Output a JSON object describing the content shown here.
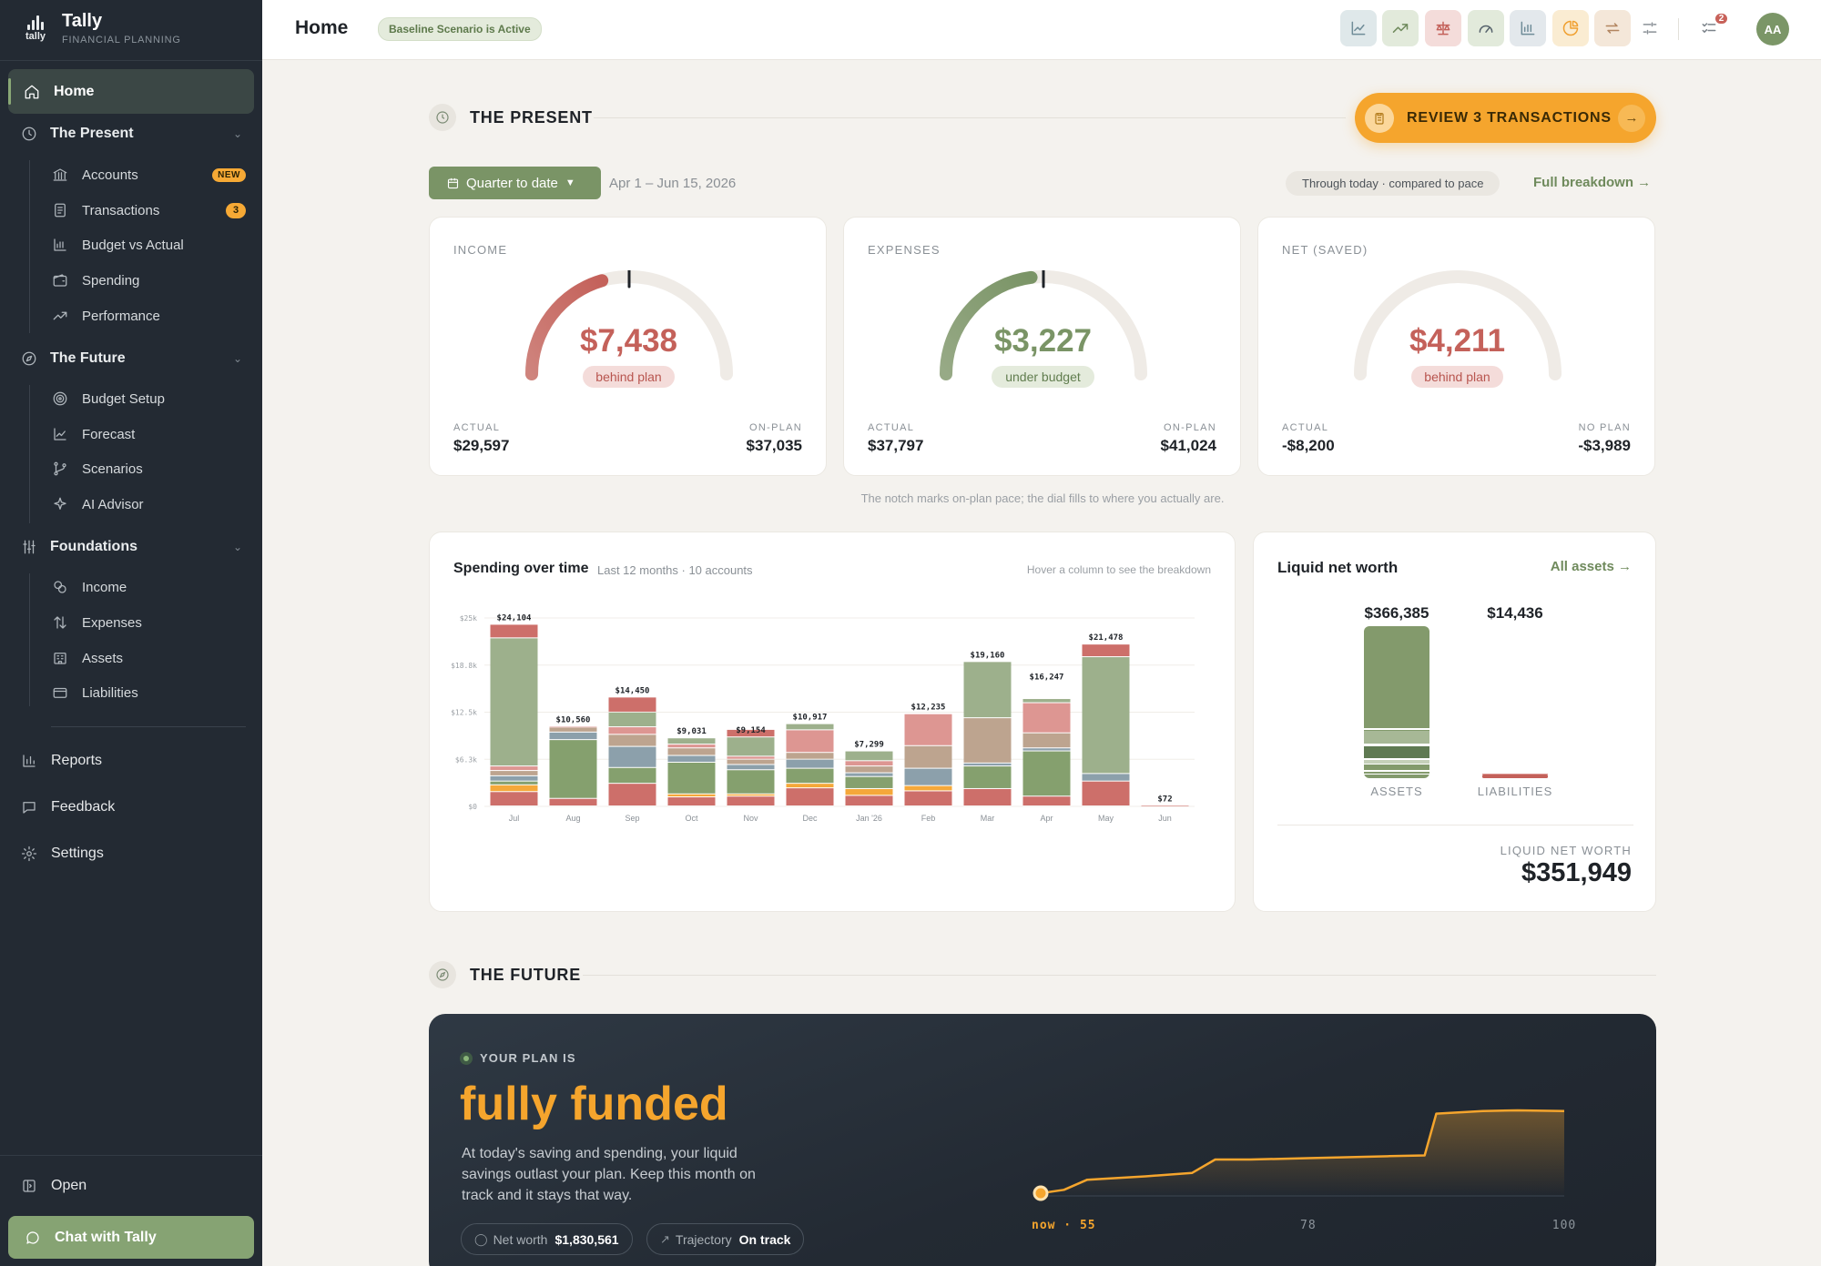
{
  "brand": {
    "name": "Tally",
    "subtitle": "FINANCIAL PLANNING",
    "logo_word": "tally"
  },
  "sidebar": {
    "home": "Home",
    "groups": [
      {
        "label": "The Present",
        "items": [
          {
            "label": "Accounts",
            "icon": "bank-icon",
            "badge": "NEW"
          },
          {
            "label": "Transactions",
            "icon": "receipt-icon",
            "badge": "3"
          },
          {
            "label": "Budget vs Actual",
            "icon": "bar-chart-icon"
          },
          {
            "label": "Spending",
            "icon": "wallet-icon"
          },
          {
            "label": "Performance",
            "icon": "trend-icon"
          }
        ]
      },
      {
        "label": "The Future",
        "items": [
          {
            "label": "Budget Setup",
            "icon": "target-icon"
          },
          {
            "label": "Forecast",
            "icon": "line-chart-icon"
          },
          {
            "label": "Scenarios",
            "icon": "branch-icon"
          },
          {
            "label": "AI Advisor",
            "icon": "sparkle-icon"
          }
        ]
      },
      {
        "label": "Foundations",
        "items": [
          {
            "label": "Income",
            "icon": "coins-icon"
          },
          {
            "label": "Expenses",
            "icon": "arrows-updown-icon"
          },
          {
            "label": "Assets",
            "icon": "building-icon"
          },
          {
            "label": "Liabilities",
            "icon": "card-icon"
          }
        ]
      }
    ],
    "reports": "Reports",
    "feedback": "Feedback",
    "settings": "Settings",
    "open": "Open",
    "chat": "Chat with Tally"
  },
  "topbar": {
    "title": "Home",
    "scenario": "Baseline Scenario is Active",
    "notifications": "2",
    "avatar": "AA",
    "tools": [
      "line-chart-icon",
      "trend-up-icon",
      "scale-icon",
      "gauge-icon",
      "bar-chart-icon",
      "pie-chart-icon",
      "repeat-icon",
      "sliders-icon"
    ]
  },
  "present": {
    "title": "THE PRESENT",
    "review_label": "REVIEW 3 TRANSACTIONS",
    "range_label": "Quarter to date",
    "range_dates": "Apr 1 – Jun 15, 2026",
    "pace_pill": "Through today · compared to pace",
    "full_breakdown": "Full breakdown →",
    "note": "The notch marks on-plan pace; the dial fills to where you actually are.",
    "gauges": [
      {
        "label": "INCOME",
        "value": "$7,438",
        "status": "behind plan",
        "fill_fraction": 0.41,
        "notch_fraction": 0.5,
        "color": "#c4615a",
        "left_label": "ACTUAL",
        "left_value": "$29,597",
        "right_label": "ON-PLAN",
        "right_value": "$37,035"
      },
      {
        "label": "EXPENSES",
        "value": "$3,227",
        "status": "under budget",
        "fill_fraction": 0.46,
        "notch_fraction": 0.5,
        "color": "#7a9466",
        "left_label": "ACTUAL",
        "left_value": "$37,797",
        "right_label": "ON-PLAN",
        "right_value": "$41,024"
      },
      {
        "label": "NET (SAVED)",
        "value": "$4,211",
        "status": "behind plan",
        "fill_fraction": 0,
        "notch_fraction": null,
        "color": "#c4615a",
        "left_label": "ACTUAL",
        "left_value": "-$8,200",
        "right_label": "NO PLAN",
        "right_value": "-$3,989"
      }
    ]
  },
  "spending": {
    "title": "Spending over time",
    "subtitle": "Last 12 months · 10 accounts",
    "hint": "Hover a column to see the breakdown"
  },
  "chart_data": {
    "type": "bar",
    "stacked": true,
    "categories": [
      "Jul",
      "Aug",
      "Sep",
      "Oct",
      "Nov",
      "Dec",
      "Jan '26",
      "Feb",
      "Mar",
      "Apr",
      "May",
      "Jun"
    ],
    "totals": [
      24104,
      10560,
      14450,
      9031,
      9154,
      10917,
      7299,
      12235,
      19160,
      16247,
      21478,
      72
    ],
    "total_labels": [
      "$24,104",
      "$10,560",
      "$14,450",
      "$9,031",
      "$9,154",
      "$10,917",
      "$7,299",
      "$12,235",
      "$19,160",
      "$16,247",
      "$21,478",
      "$72"
    ],
    "y_ticks": [
      "$0",
      "$6.3k",
      "$12.5k",
      "$18.8k",
      "$25k"
    ],
    "ylim": [
      0,
      25000
    ],
    "colors": [
      "#cd6f6a",
      "#f5a83a",
      "#85a06e",
      "#8ca0ab",
      "#bda48f",
      "#dd9692",
      "#9db08c"
    ],
    "segments": [
      [
        1900,
        900,
        500,
        700,
        700,
        600,
        17000,
        1804
      ],
      [
        1000,
        0,
        7800,
        1000,
        660,
        100
      ],
      [
        3000,
        0,
        2100,
        2800,
        1600,
        1000,
        1950,
        2000
      ],
      [
        1200,
        400,
        4200,
        900,
        1000,
        500,
        831
      ],
      [
        1300,
        300,
        3200,
        700,
        700,
        400,
        2554,
        1000
      ],
      [
        2400,
        600,
        2000,
        1200,
        900,
        3000,
        817
      ],
      [
        1400,
        900,
        1600,
        500,
        900,
        700,
        1299
      ],
      [
        2000,
        700,
        0,
        2300,
        3000,
        4235
      ],
      [
        2300,
        0,
        3000,
        400,
        6000,
        0,
        7460
      ],
      [
        1300,
        0,
        6000,
        400,
        2000,
        4000,
        547
      ],
      [
        3300,
        0,
        0,
        1000,
        0,
        0,
        15500,
        1678
      ],
      [
        72
      ]
    ]
  },
  "networth": {
    "title": "Liquid net worth",
    "link": "All assets →",
    "chart_data": {
      "type": "bar",
      "categories": [
        "ASSETS",
        "LIABILITIES"
      ],
      "values": [
        366385,
        14436
      ],
      "value_labels": [
        "$366,385",
        "$14,436"
      ]
    },
    "total_label": "LIQUID NET WORTH",
    "total_value": "$351,949"
  },
  "future": {
    "title": "THE FUTURE",
    "tag": "YOUR PLAN IS",
    "headline": "fully funded",
    "description": "At today's saving and spending, your liquid savings outlast your plan. Keep this month on track and it stays that way.",
    "chips": [
      {
        "label": "Net worth",
        "value": "$1,830,561"
      },
      {
        "label": "Trajectory",
        "value": "On track"
      }
    ],
    "axis": [
      "now · 55",
      "78",
      "100"
    ],
    "chart_data": {
      "type": "line",
      "x": [
        55,
        57,
        59,
        64,
        68,
        70,
        73,
        78,
        85,
        88,
        89,
        93,
        96,
        100
      ],
      "y": [
        0,
        0.05,
        0.2,
        0.25,
        0.3,
        0.5,
        0.5,
        0.52,
        0.55,
        0.56,
        1.18,
        1.22,
        1.23,
        1.22
      ]
    }
  }
}
